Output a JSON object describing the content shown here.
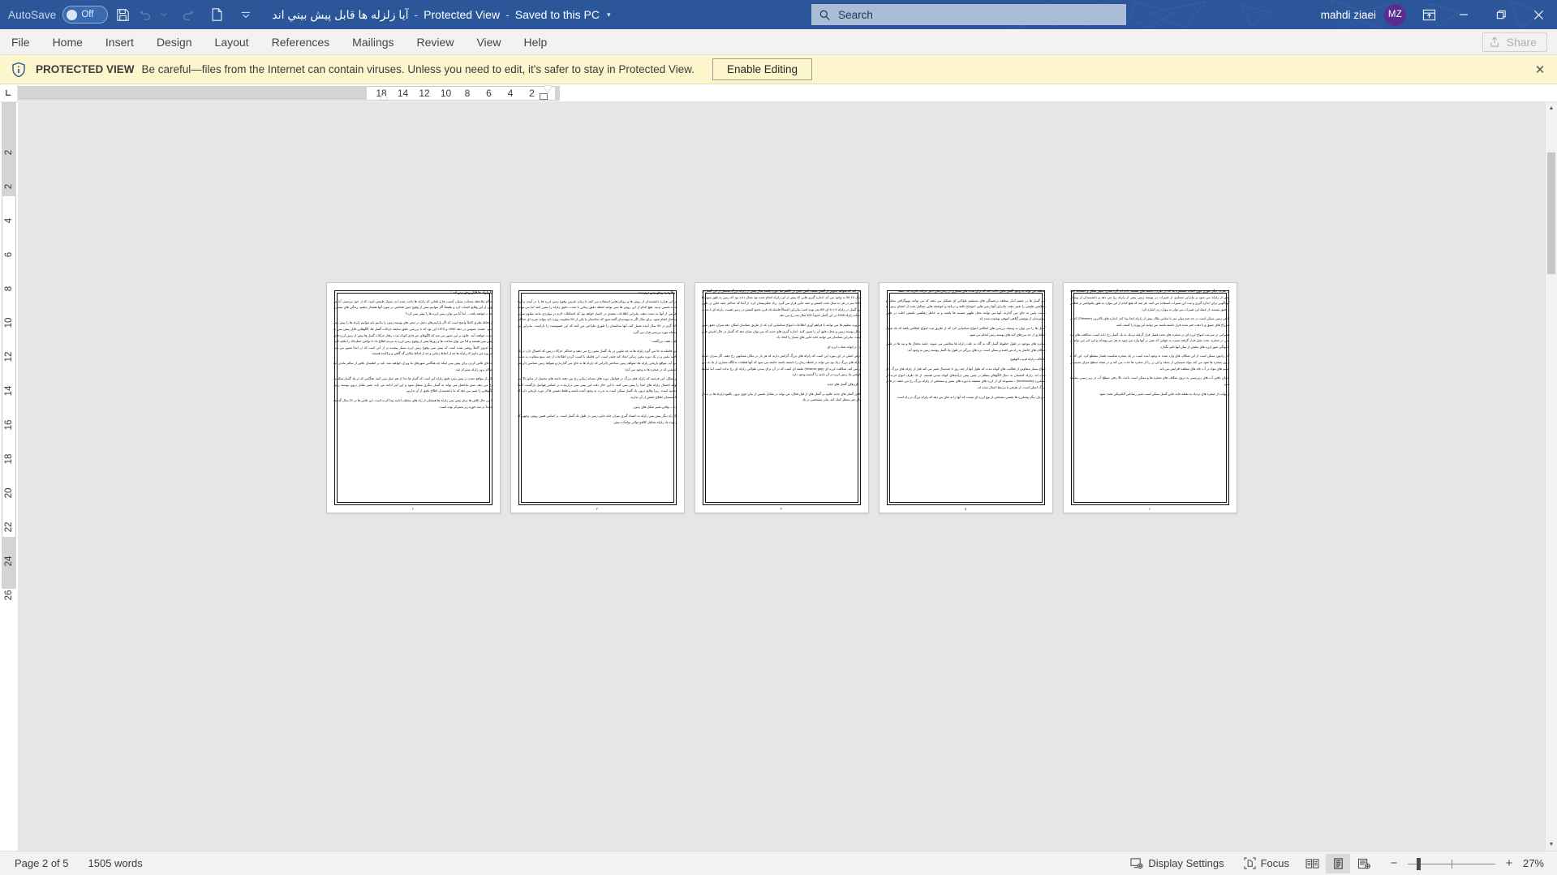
{
  "titlebar": {
    "autosave_label": "AutoSave",
    "autosave_state": "Off",
    "save_icon": "save-icon",
    "undo_icon": "undo-icon",
    "redo_icon": "redo-icon",
    "newdoc_icon": "new-document-icon",
    "customize_icon": "customize-quick-access-toolbar-icon",
    "doc_name": "آيا زلزله ها قابل پيش بيني اند",
    "separator": "-",
    "protected_view": "Protected View",
    "saved_state": "Saved to this PC",
    "title_caret": "▾",
    "user_name": "mahdi ziaei",
    "user_initials": "MZ",
    "ribbon_display_icon": "ribbon-display-options-icon",
    "minimize_icon": "minimize-icon",
    "restore_icon": "restore-icon",
    "close_icon": "close-icon"
  },
  "search": {
    "placeholder": "Search",
    "icon": "search-icon"
  },
  "ribbon": {
    "tabs": [
      {
        "label": "File"
      },
      {
        "label": "Home"
      },
      {
        "label": "Insert"
      },
      {
        "label": "Design"
      },
      {
        "label": "Layout"
      },
      {
        "label": "References"
      },
      {
        "label": "Mailings"
      },
      {
        "label": "Review"
      },
      {
        "label": "View"
      },
      {
        "label": "Help"
      }
    ],
    "share_label": "Share",
    "share_icon": "share-icon"
  },
  "protected_view": {
    "icon": "shield-info-icon",
    "badge": "PROTECTED VIEW",
    "message": "Be careful—files from the Internet can contain viruses. Unless you need to edit, it's safer to stay in Protected View.",
    "enable_editing_label": "Enable Editing",
    "close_icon": "close-icon",
    "close_glyph": "✕"
  },
  "ruler": {
    "tab_selector_icon": "tab-stop-left-icon",
    "tab_selector_glyph": "L",
    "horizontal_ticks": [
      "18",
      "14",
      "12",
      "10",
      "8",
      "6",
      "4",
      "2"
    ],
    "vertical_ticks": [
      "2",
      "2",
      "4",
      "6",
      "8",
      "10",
      "12",
      "14",
      "16",
      "18",
      "20",
      "22",
      "24",
      "26"
    ]
  },
  "document": {
    "colors": {
      "page": "#ffffff",
      "canvas": "#e6e6e6",
      "accent": "#2b579a",
      "warning_bg": "#fdf6cd"
    },
    "pages": [
      {
        "heading": "آيا زلزله ها قابل پيش بيني اند :",
        "paragraphs": [
          "هنگام ملاحظه مصائب بسيار، آسيب ها و تلفاتي كه زلزله ها باعث شده اند، بسيار طبيعي است كه از خود بپرسيم، آيا مي توان از اين وقايع اجتناب كرد و طبيعتاً اگر بتوانيم پيش از وقوع چنين فجايعي در مورد آنها هشدار بدهيم، زندگي هاي بسياري نجات خواهند يافت... اما آيا مي توان زمين لرزه ها را پيش بيني كرد؟",
          "از لحاظ نظري كاملاً واضح است كه اگر پارامترهاي دخيل در تنش هاي پوسته زمين را بدانيم بايد بتوانيم زلزله ها را پيش بيني كنيم. عقيده عمومي در دهه 1960 و 1970 اين بود كه با بررسي دقيق سابقه حركات گسل ها، الگوهايي قابل پيش بيني به دست خواهند آمد. علاوه بر اين تصور مي شد كه الگوهاي غيرعادي كوتاه مدت رفتار حركات گسل ها پيش از زمين لرزه قابل پيش بيني هستند و لذا مي توان ساعت ها و روزها پيش از وقوع زمين لرزه به مردم اطلاع داد تا نواحي خطرناك را تخليه كنند. اما امروز كاملاً روشن شده است كه پيش بيني وقوع زمين لرزه بسيار پيچيده تر از آني است كه در ابتدا تصور مي شد. امروزه مي دانيم كه زلزله ها چه از لحاظ زماني و چه از لحاظ مكاني گه گاهي و پراكنده هستند.",
          "به جاي تلاش كردن براي پيش بيني اينكه چه هنگامي شهرهاي ما ويران خواهند شد، بايد بر اطمينان يافتن از سالم ماندن آنها هنگام بروز زلزله متمركز شد.",
          "يكي از مواقع عمده در پيش بيني دقيق زلزله اين است كه گسل ها جدا از هم عمل نمي كنند. هنگامي كه در يك گسل شكست رخ مي دهد، تنش ماحصل مي تواند به گسل ديگري منتقل شود و اين امر ادامه مي يابد. تغيير تقابل درون پوسته زمين الگوهايي را تغيير مي دهد كه ما دانشمندان اطلاع دقيق از آن نداريم.",
          "با اين حال تلاش ها براي پيش بيني زلزله ها همچنان از راه هاي مختلف ادامه پيدا كرده است. اين تلاش ها در 20 سال گذشته عمدتاً در سه حوزه زير متمركز بوده است."
        ],
        "footer": "۲"
      },
      {
        "heading": "- وقارصيه پيش بيني درنيمده",
        "paragraphs": [
          "در اين هزاره دانشمندان از روش ها و رويكردهايي استفاده مي كنند تا زمان تقريبي وقوع زمين لرزه ها را در آينده برآورد شده تخمين بزنند. هيچ كدام از اين روش ها نمي توانند لحظه دقيق زماني يا شدت دقيق زلزله را معين كنند اما مي توانند تقريبي از آنها به دست دهند. بنابراين اطلاعات مفيدي در اختيار خواهد بود كه احتياطات لازم در مواردي مانند مقاوم سازي ساختار انجام شود. براي مثال اگر به مهندسان گفته شود كه ساختمان با يكي از 50 مقاومت ويژه بايد بتواند ضربه اي حداكثر 0/5 گرم در 50 سال آينده تحمل كند، آنها ساختمان را طوري طراحي مي كنند كه اين خصوصيت را داراست. بنابراين اين مسئله مورد بررسي قرار مي گيرد.",
          "الف: هفت بزرگشت",
          "اين فاصله به جا مي گيرد زلزله ها به چه تناوبي در يك گسل معين رخ مي دهند و حداكثر حركات زمين كه احتمال دارد در يك ناحيه معين و در يك دوره معين زماني ايجاد كند چقدر است. اين فاصله با كسب كردن اطلاعات از چند منبع متفاوت به دست مي آيد. مواقع تاريخي زلزله ها، شواهد زمين شناختي (اثراتي كه زلزله ها به جاي مي گذارند) و شواهد زمين شناسي (لرزش كششي كه در صخره ها به وجود مي آيد).",
          "بر شكل، اين فرضيه كه زلزله هاي بزرگ در فواصل دوره هاي مشابه زماني رخ مي دهند دامنه هاي محتمل از منابع بالا مي تواند احتمال زلزله هاي ابتدا را پيش بيني كنند. با اين حال دقت اين پيش بيني درازمدت بر اساس فواصل بازگشت كاملاً محدود است، زيرا وقايع درون يك گسل ممكن است به ندرت به وجود آمده باشند و فقط تخمين ها از دوره تاريخي دارد كه دانشمندان اطلاع دقيقي از آن ندارند.",
          "ب — وقايي تغيير شكل هاي زمين:",
          "يك راه ديگر پيش بيني زلزله به اعتماد گيري ميزان جابه جايي زمين در طول يك گسل است. بر اساس همين روش، وجهي كه و توده يك زلزله تشكيل كالقم توالي نواسات پيش"
        ],
        "footer": "۳"
      },
      {
        "heading": "",
        "paragraphs": [
          "مي كند كه شواهد بجويي از گسل سمت آشن نامي در كالقم شا حوزه يكصد سال پيش از زلزله بزرگ محتمل از اين گسل در سال 19 06 به وجود مي آيد. اندازه گيري هايي كه پيش از اين زلزله انجام شده بود نشان داده بود كه زمين به طور متوسط 0/65 متر در هر ده سال تحت كشش و جنبه جايي قرار مي گيرد. زياد خطرنيشان كرد، از آنجا كه حداكثر جنبه جايي در طول اين گسل در زلزله 9 1-6 اي 6/5 متر بوده است بنابراين احتمالاً فاصله يك قرن تجمع كشش در زمين هست. زلزله اي با شدت مشابه زلزله 1906 در اين گسل حدوداً 100 سال بعد رخ مي دهد.",
          "امروزه معلوم ها مي توانند با فراهم آوري اطلاعات امواج شناسايي كرد كه از طريق شناسان امكان دهد ميزان دقيق تغيير شكل پوسته زمين و محل دقيق آن را تعيين كنند. اندازه گيري هاي جديد كه مي توان نشان دهد كه گسل در حال لغزش قرار است. بنابراين شناسان مي توانند جابه جايي هاي بسيار را اتخاذ داد.",
          "ج - درخواند شتاب لرزه اي",
          "فرض اصلي در اين مورد اين است كه زلزله هاي بزرگ گرايش دارند كه هر بار در مكان مشابهي رخ دهند، اگر ميزان عمده زلزله هاي بزرگ زياد بود مي تواند در لحظه زمان را دانسته باشند جامعه مي نمود كه آنها قطعات بدانگاه معياري از يك به مرز بر مي كند. شكافت لرزه اي (Seismic gap) طبقه اي است كه در آن براي مدتي طولاني زلزله اي رخ نداده است اما سابقه تاريخي يك زمين لرزه در آن ناحيه را گذشته وجود دارد.",
          "... لرزهكن گسل هاي جديد",
          "يافتن گسل هاي جديد علاوه بر گسل هاي از قبل فعال، مي تواند در مقابل تخمين از بيان جوي بروز، بالقوه زلزله ها در مكان هاي غير منتظر كمك كند. بنابر مشخصي در يك"
        ],
        "footer": "۴"
      },
      {
        "heading": "",
        "paragraphs": [
          "منطقه مي تواند به وجود گسل هايي دلالت كند كه براي مدت هاي بسياري در زمان هاي اخير حركت نكرده اند. جمله:",
          "اين گسل ها در چشم انداز منطقه برجستگي هاي مستقيم طولاني اي تشكيل مي دهند كه مي توانند توپوگرافي محلي و زهكشي طبيعي را تغيير دهند. بنابراين آنها زمين هايي اعوجاج يافته و درياچه و حوضچه هايي تشكيل شده از انحناي زمين به سمت پايين به جاي مي گذارند. آنها مي توانند محل ظهور چشمه ها باشند و به خاطر زهكشي طبيعي اغلب در طول مسيرشان از پوشش گياهي انبوهي پوشيده شده اند.",
          "گسل ها را مي توان به وسيله بررسي هاي انعكاس امواج شناسايي كرد كه از طريق ثبت امواج انعكاس يافته كه يك شوك انفجاري از حد مرزهاي لايه هاي پوسته زمين انجام مي شود.",
          "صخره هاي موجود در طول خطوط گسل گاه به گاه به علت زلزله ها متلاشي مي شوند. غصه يخچال ها و تپه ها در طول شكاف هاي حاصل به راه مي افتند و ممكن است دره هاي بزرگي در طول يك گسل پوسته زمين به وجود آيد.",
          "-3حالت زلزله قريب الوقوع",
          "انواع بسيار متفاوتي از فعاليت هاي كوتاه مدت كه طول آنها از چند روز تا چندسال تغيير مي كند قبل از زلزله هاي بزرگ ذكر شده اند. زلزله كنشمان به دنبال الگوهاي منظم در چنين پيش درآمدهاي كوتاه مدتي هستند. از يك طرف انواع خرده اي پيشلرزه (foreshocks) ، مجموعه اي از لرزه هاي ضعيفه با دوره هاي معين و مشخص از زلزله بزرگ رخ مي دهند، در قابل بزرگ اصلي است. از طرفي با مرتبط اعمال شده اند.",
          "به زبان ديگر پيشلرزه ها بخشي مشخص از نوع لرزه اي نيست كه آنها را به جاي مي دهد كه زلزله بزرگ در راه است."
        ],
        "footer": "۵"
      },
      {
        "heading": "",
        "paragraphs": [
          "از طرف ديگر تئوري قوي العاده مسطره ها كه در طرف جامعه هاي هستند داده اند گرد شدن، تغيير شكل و انبساط ابتدا پيش از زلزله مي شود و بنابراين شماري از تغييرات در پوسته زمين پيش از زلزله رخ مي دهد و دانشمندان از وسائل گوناگوني براي اندازه گيري و ثبت اين تغييرات استفاده مي كنند. هر چند كه هيچ كدام از اين موارد به طور يكنواختي بر قطعي و دقيق نيستند، از جمله اين تغييرات مي توان به موارد زير اشاره كرد.",
          "كاهي زمين ممكن است در حد چند ميلي متر تا ساتني ملاك پيش از زلزله انجا بيدا كند. اندازه هاي بالاترين (Tiltmeter) كه در سوراخ هاي عميق و با دقت حفر شده قرار داشته باشند مي توانند اين ويژه را كشف كنند.",
          "تغييراتي در سرعت امواج لرزه اي در صخره هاي تحت فشار قرار گرفته نزديك به يك گسل رخ داده است. شكافت هاي نزد بيني در صخره، تحت تنش قرار گرفته نسبت به جهاتي كه تنش بر آنها وارد مي شود به هر مي پوشاند و اين امر مي تواند بر چگونگي عبور لرزه هاي مخفي از ميان آنها تاثير بگذارد.",
          "گاز راديون ممكن است از اين شكاف هاي وارد شده به وجود آمده است در يك صخره شكست فشار منقطع كرد. اين كه به درون صخره ها نفوذ مي كند مواد شيميايي از جمله و اين زر را از صخره ها جذب مي كند و در نتيجه سطح ميزان شيميايي چشم هاي مواد در آب چاه هاي منطقه افزايش مي يابد.",
          "جريان يافتن آب هاي زيرزميني به درون شكاف هاي صخره ها و ممكن است باعث بالا رفتن سطح آب در زير زميني منطقه شود.",
          "درنهايت از صخره هاي نزديك به نقطه جابه جايي گسل ممكن است تغيير رسانايي الكتريكي تشدد شود."
        ],
        "footer": "۶"
      }
    ]
  },
  "statusbar": {
    "page_info": "Page 2 of 5",
    "word_count": "1505 words",
    "display_settings_label": "Display Settings",
    "display_settings_icon": "display-settings-icon",
    "focus_label": "Focus",
    "focus_icon": "focus-mode-icon",
    "view_read_icon": "read-mode-icon",
    "view_print_icon": "print-layout-icon",
    "view_web_icon": "web-layout-icon",
    "zoom_out_glyph": "−",
    "zoom_in_glyph": "+",
    "zoom_level": "27%"
  }
}
